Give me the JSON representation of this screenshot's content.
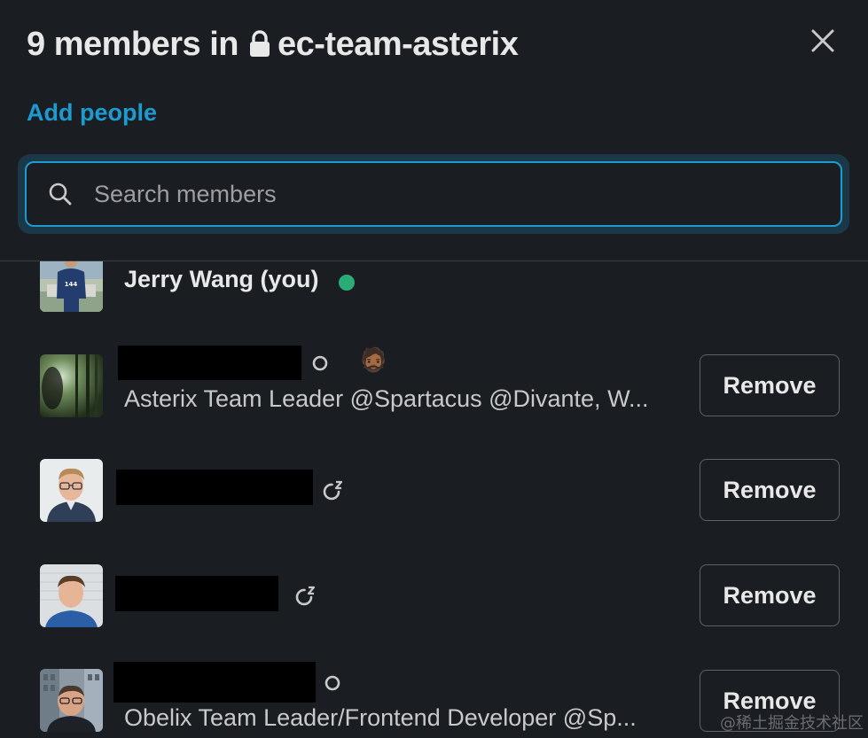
{
  "header": {
    "title_prefix": "9 members in",
    "channel_name": "ec-team-asterix",
    "channel_private": true
  },
  "actions": {
    "add_people_label": "Add people"
  },
  "search": {
    "placeholder": "Search members",
    "value": ""
  },
  "members": [
    {
      "name": "Jerry Wang (you)",
      "status": "online",
      "subtitle": "",
      "removable": false
    },
    {
      "name": "",
      "status": "away",
      "emoji": "🧔🏾",
      "subtitle": "Asterix Team Leader @Spartacus @Divante, W...",
      "removable": true,
      "remove_label": "Remove"
    },
    {
      "name": "",
      "status": "dnd-snooze",
      "subtitle": "",
      "removable": true,
      "remove_label": "Remove"
    },
    {
      "name": "",
      "status": "dnd-snooze",
      "subtitle": "",
      "removable": true,
      "remove_label": "Remove"
    },
    {
      "name": "",
      "status": "away",
      "subtitle": "Obelix Team Leader/Frontend Developer @Sp...",
      "removable": true,
      "remove_label": "Remove"
    }
  ],
  "icons": {
    "lock": "lock-icon",
    "close": "close-icon",
    "search": "search-icon",
    "online": "online-dot-icon",
    "away": "away-ring-icon",
    "snooze": "snooze-icon"
  },
  "colors": {
    "background": "#1a1d21",
    "accent": "#1d9bd1",
    "online": "#2bac76",
    "text": "#d1d2d3"
  },
  "watermark": "@稀土掘金技术社区"
}
